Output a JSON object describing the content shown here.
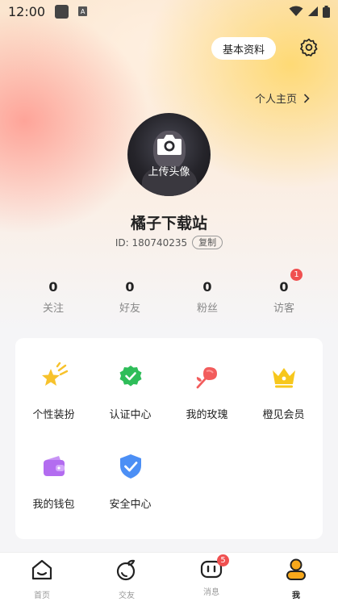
{
  "status_bar": {
    "time": "12:00",
    "notif_glyph": "A"
  },
  "header": {
    "profile_chip_label": "基本资料",
    "homepage_link_label": "个人主页"
  },
  "avatar": {
    "upload_label": "上传头像"
  },
  "user": {
    "name": "橘子下载站",
    "id_label": "ID: 180740235",
    "copy_label": "复制"
  },
  "stats": [
    {
      "value": "0",
      "label": "关注"
    },
    {
      "value": "0",
      "label": "好友"
    },
    {
      "value": "0",
      "label": "粉丝"
    },
    {
      "value": "0",
      "label": "访客",
      "badge": "1"
    }
  ],
  "features": [
    {
      "label": "个性装扮",
      "icon": "star-sparkle-icon",
      "color": "#f7c22c"
    },
    {
      "label": "认证中心",
      "icon": "verified-badge-icon",
      "color": "#2ebd59"
    },
    {
      "label": "我的玫瑰",
      "icon": "rose-icon",
      "color": "#f25c5c"
    },
    {
      "label": "橙见会员",
      "icon": "crown-icon",
      "color": "#f7c71c"
    },
    {
      "label": "我的钱包",
      "icon": "wallet-icon",
      "color": "#b36cf0"
    },
    {
      "label": "安全中心",
      "icon": "shield-check-icon",
      "color": "#4c8ff5"
    }
  ],
  "tabbar": {
    "tabs": [
      {
        "label": "首页",
        "icon": "home-icon"
      },
      {
        "label": "交友",
        "icon": "peach-icon"
      },
      {
        "label": "消息",
        "icon": "message-icon",
        "badge": "5"
      },
      {
        "label": "我",
        "icon": "person-icon",
        "active": true
      }
    ]
  },
  "colors": {
    "accent": "#f7a81b",
    "badge": "#f05050"
  }
}
